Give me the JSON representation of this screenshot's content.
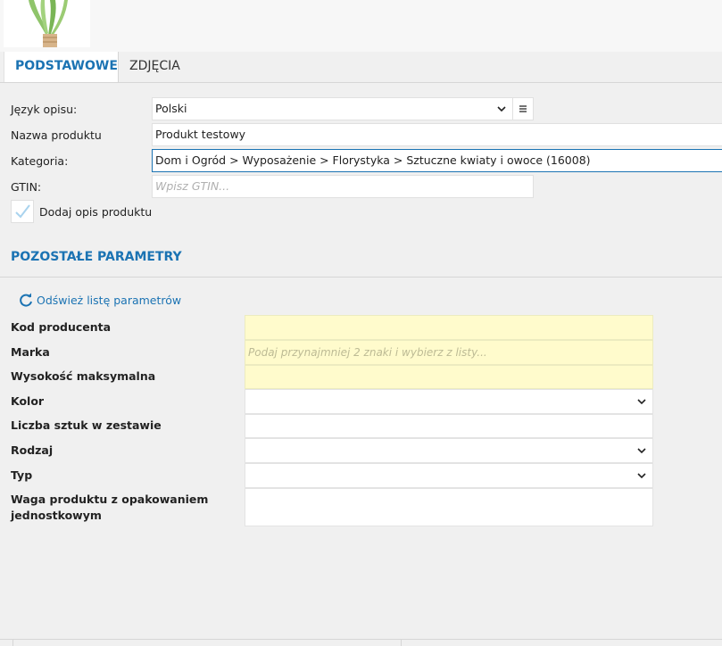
{
  "tabs": {
    "basic": "PODSTAWOWE",
    "photos": "ZDJĘCIA"
  },
  "form": {
    "language_label": "Język opisu:",
    "language_value": "Polski",
    "name_label": "Nazwa produktu",
    "name_value": "Produkt testowy",
    "category_label": "Kategoria:",
    "category_value": "Dom i Ogród > Wyposażenie > Florystyka > Sztuczne kwiaty i owoce (16008)",
    "gtin_label": "GTIN:",
    "gtin_placeholder": "Wpisz GTIN...",
    "add_description_label": "Dodaj opis produktu"
  },
  "params": {
    "section_title": "POZOSTAŁE PARAMETRY",
    "refresh_label": "Odśwież listę parametrów",
    "producer_code_label": "Kod producenta",
    "brand_label": "Marka",
    "brand_placeholder": "Podaj przynajmniej 2 znaki i wybierz z listy...",
    "max_height_label": "Wysokość maksymalna",
    "color_label": "Kolor",
    "pieces_label": "Liczba sztuk w zestawie",
    "kind_label": "Rodzaj",
    "type_label": "Typ",
    "weight_label_line1": "Waga produktu z opakowaniem",
    "weight_label_line2": "jednostkowym"
  },
  "icons": {
    "language_select": "chevron-down-icon",
    "language_list": "list-icon",
    "refresh": "refresh-icon",
    "checkbox": "checkmark-icon"
  },
  "colors": {
    "accent": "#1b73b3",
    "required_bg": "#fffbcc"
  }
}
